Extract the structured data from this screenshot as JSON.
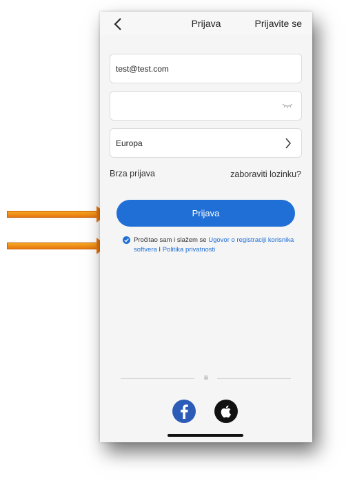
{
  "header": {
    "title": "Prijava",
    "register_label": "Prijavite se"
  },
  "form": {
    "email_value": "test@test.com",
    "password_value": "",
    "region_label": "Europa"
  },
  "links": {
    "quick_login": "Brza prijava",
    "forgot_password": "zaboraviti lozinku?"
  },
  "login_button_label": "Prijava",
  "agreement": {
    "checked": true,
    "prefix": "Pročitao sam i slažem se ",
    "terms_link": "Ugovor o registraciji korisnika softvera",
    "separator": " I ",
    "privacy_link": "Politika privatnosti"
  },
  "divider_label": "ili",
  "social": [
    "facebook-icon",
    "apple-icon"
  ],
  "colors": {
    "accent": "#1f6fd6",
    "arrow": "#e8780f"
  }
}
